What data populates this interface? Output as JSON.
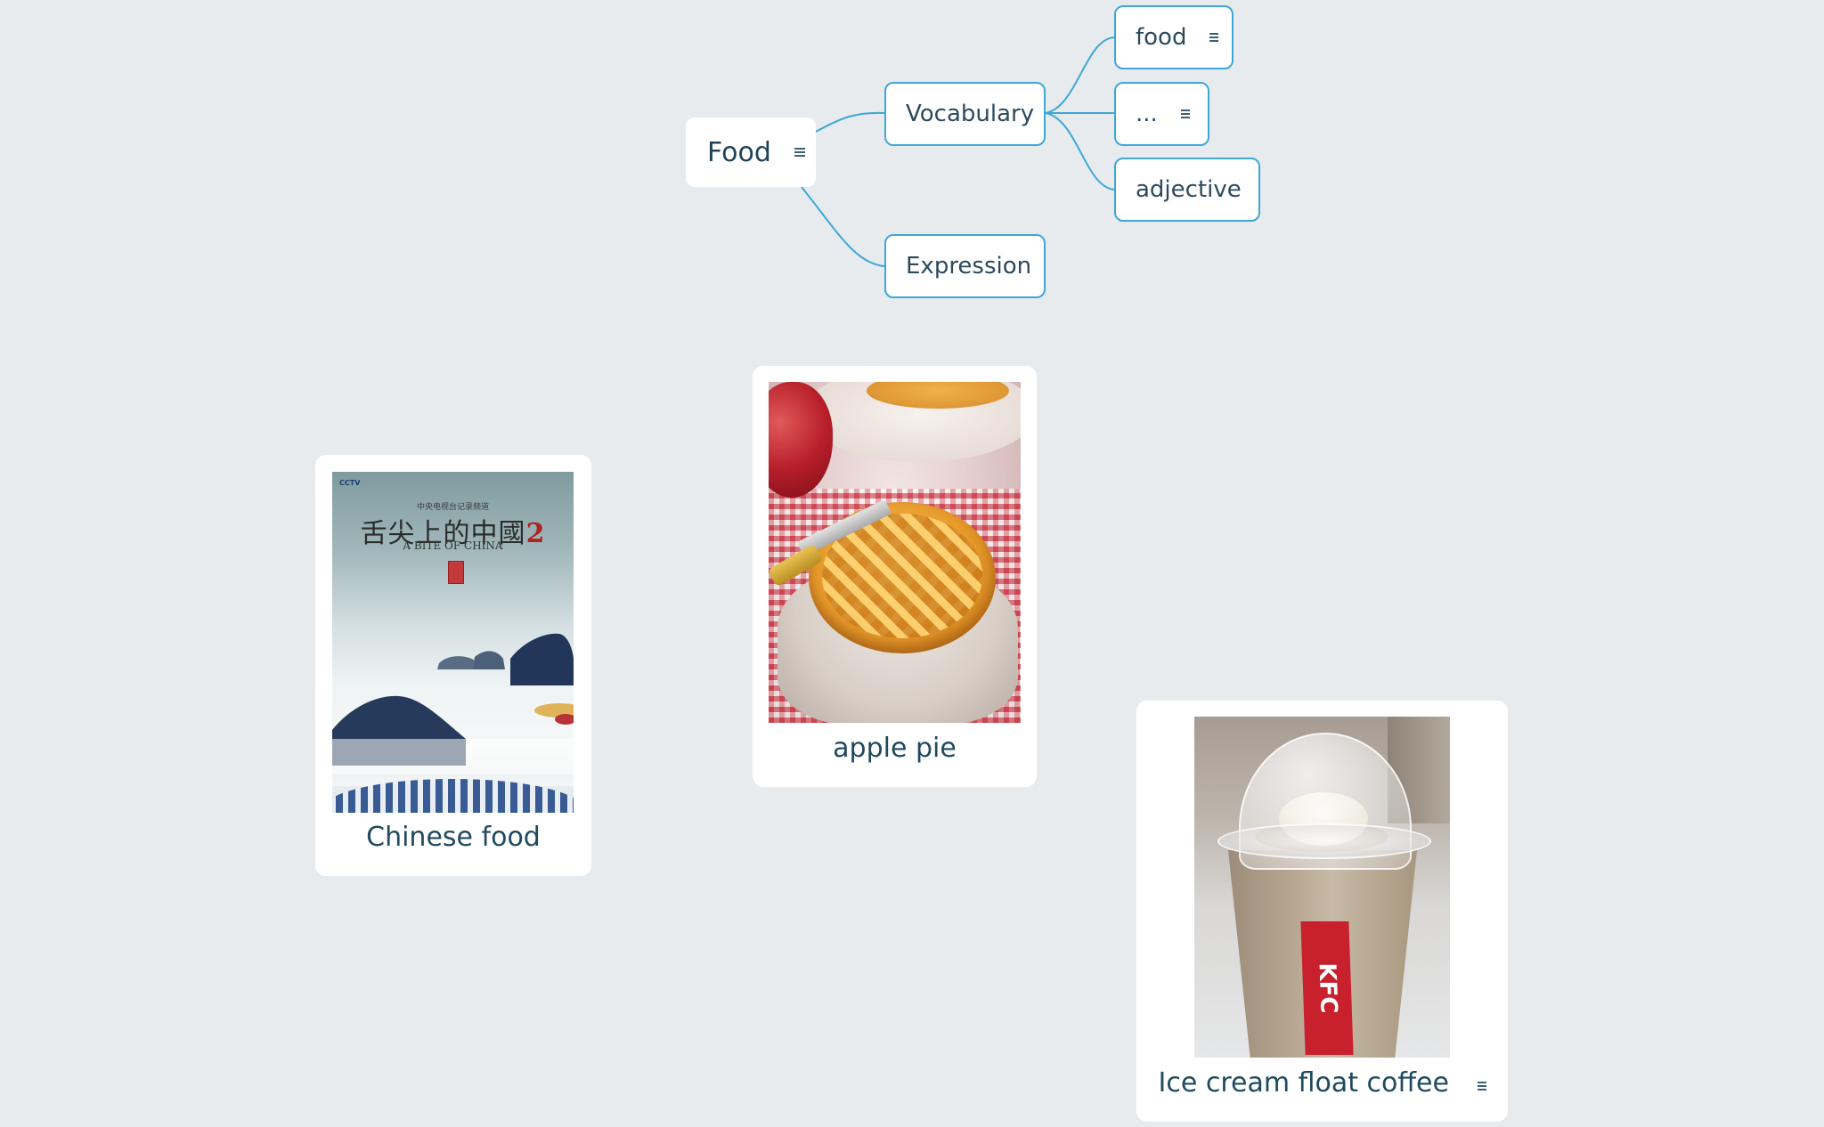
{
  "mindmap": {
    "root": {
      "label": "Food",
      "has_note": true
    },
    "branches": [
      {
        "label": "Vocabulary",
        "children": [
          {
            "label": "food",
            "has_note": true
          },
          {
            "label": "...",
            "has_note": true
          },
          {
            "label": "adjective",
            "has_note": false
          }
        ]
      },
      {
        "label": "Expression",
        "children": []
      }
    ],
    "line_color": "#3ea7d6"
  },
  "cards": [
    {
      "caption": "Chinese food",
      "image": {
        "kind": "poster",
        "top_line": "中央电视台记录频道",
        "title": "舌尖上的中國",
        "title_suffix": "2",
        "subtitle": "A BITE OF CHINA",
        "logo": "CCTV"
      },
      "has_note": false
    },
    {
      "caption": "apple pie",
      "image": {
        "kind": "photo"
      },
      "has_note": false
    },
    {
      "caption": "Ice cream float coffee",
      "image": {
        "kind": "photo",
        "brand": "KFC"
      },
      "has_note": true
    }
  ],
  "colors": {
    "background": "#e8ebee",
    "node_border": "#3ea7d6",
    "text": "#2c4a5e"
  }
}
